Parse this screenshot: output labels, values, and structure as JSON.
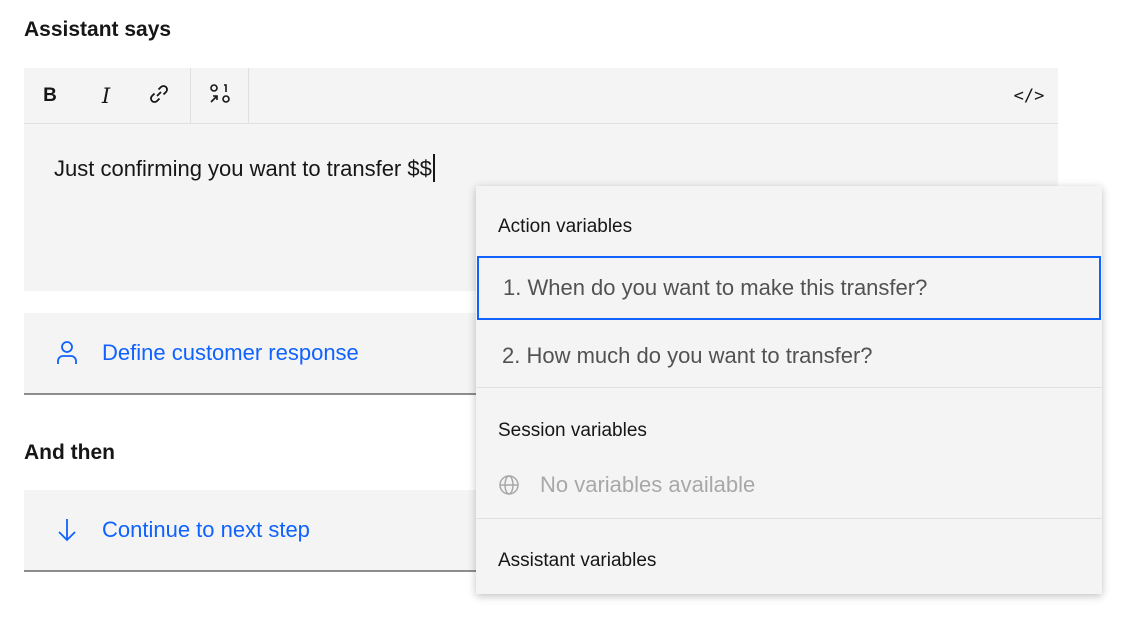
{
  "assistant_says": {
    "heading": "Assistant says",
    "toolbar": {
      "bold": "B",
      "italic": "I",
      "code": "</>"
    },
    "text": "Just confirming you want to transfer $$"
  },
  "customer_response": {
    "label": "Define customer response",
    "icon": "user-icon"
  },
  "and_then": {
    "heading": "And then",
    "label": "Continue to next step",
    "icon": "arrow-down-icon"
  },
  "variables_dropdown": {
    "action_title": "Action variables",
    "action_items": [
      "1. When do you want to make this transfer?",
      "2. How much do you want to transfer?"
    ],
    "selected_index": 0,
    "session_title": "Session variables",
    "session_empty": "No variables available",
    "assistant_title": "Assistant variables"
  },
  "colors": {
    "accent": "#0f62fe",
    "field_bg": "#f4f4f4",
    "text": "#161616",
    "muted": "#a8a8a8"
  }
}
